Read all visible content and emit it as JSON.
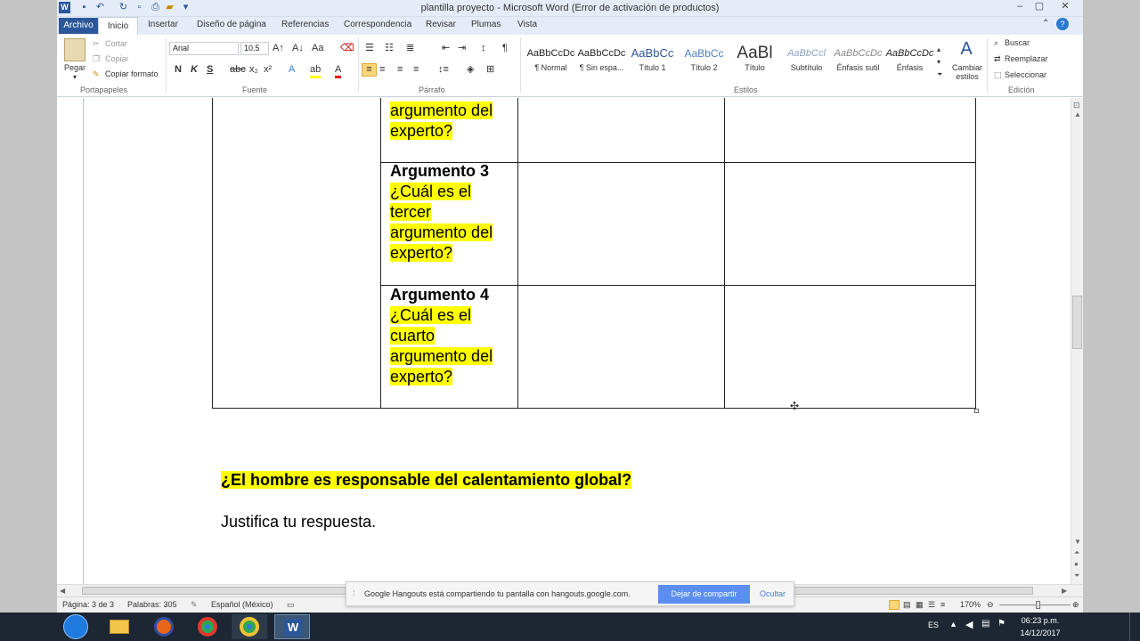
{
  "window": {
    "title": "plantilla proyecto - Microsoft Word (Error de activación de productos)"
  },
  "tabs": {
    "file": "Archivo",
    "home": "Inicio",
    "insert": "Insertar",
    "page_layout": "Diseño de página",
    "references": "Referencias",
    "mailings": "Correspondencia",
    "review": "Revisar",
    "add_ins": "Plumas",
    "view": "Vista"
  },
  "clipboard": {
    "paste": "Pegar",
    "cut": "Cortar",
    "copy": "Copiar",
    "format_painter": "Copiar formato",
    "label": "Portapapeles"
  },
  "font": {
    "name": "Arial",
    "size": "10.5",
    "label": "Fuente"
  },
  "paragraph": {
    "label": "Párrafo"
  },
  "styles": {
    "label": "Estilos",
    "change_label": "Cambiar estilos",
    "items": [
      {
        "preview": "AaBbCcDc",
        "name": "¶ Normal"
      },
      {
        "preview": "AaBbCcDc",
        "name": "¶ Sin espa..."
      },
      {
        "preview": "AaBbCc",
        "name": "Título 1"
      },
      {
        "preview": "AaBbCc",
        "name": "Título 2"
      },
      {
        "preview": "AaBl",
        "name": "Título"
      },
      {
        "preview": "AaBbCcl",
        "name": "Subtítulo"
      },
      {
        "preview": "AaBbCcDc",
        "name": "Énfasis sutil"
      },
      {
        "preview": "AaBbCcDc",
        "name": "Énfasis"
      }
    ]
  },
  "editing": {
    "find": "Buscar",
    "replace": "Reemplazar",
    "select": "Seleccionar",
    "label": "Edición"
  },
  "document": {
    "row0": {
      "q_line1": "argumento del",
      "q_line2": "experto?"
    },
    "row1": {
      "heading": "Argumento 3",
      "q_line1": "¿Cuál es el",
      "q_line2": "tercer",
      "q_line3": "argumento del",
      "q_line4": "experto?"
    },
    "row2": {
      "heading": "Argumento 4",
      "q_line1": "¿Cuál es el",
      "q_line2": "cuarto",
      "q_line3": "argumento del",
      "q_line4": "experto?"
    },
    "question": "¿El hombre es responsable del calentamiento global?",
    "instruction": "Justifica tu respuesta."
  },
  "status": {
    "page": "Página: 3 de 3",
    "words": "Palabras: 305",
    "language": "Español (México)",
    "zoom": "170%"
  },
  "share_bar": {
    "message": "Google Hangouts está compartiendo tu pantalla con hangouts.google.com.",
    "stop": "Dejar de compartir",
    "hide": "Ocultar"
  },
  "taskbar": {
    "lang": "ES",
    "time": "06:23 p.m.",
    "date": "14/12/2017"
  },
  "colors": {
    "accent": "#2b579a",
    "highlight": "#ffff00"
  }
}
